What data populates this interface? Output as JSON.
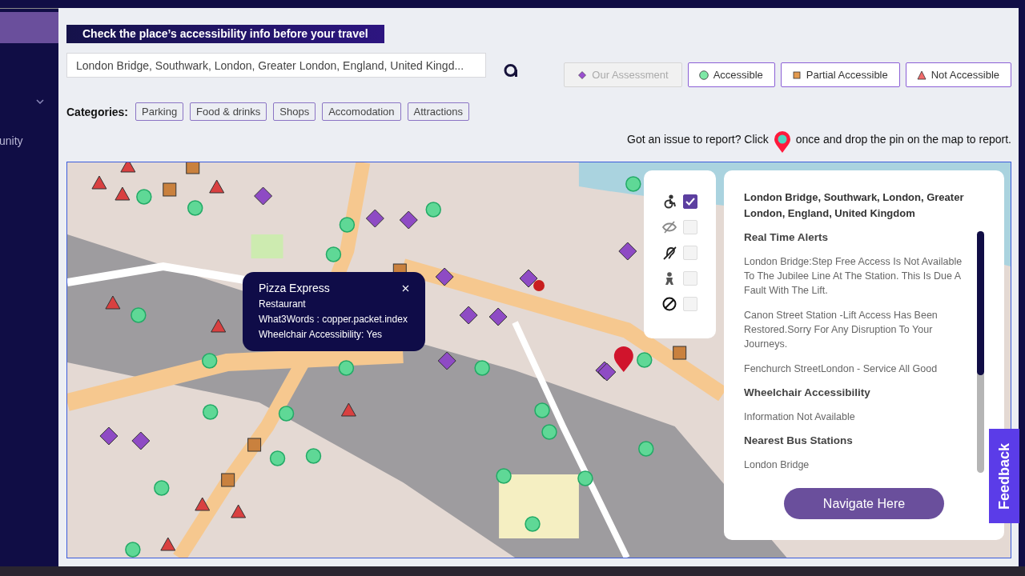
{
  "sidebar": {
    "partial_label": "unity"
  },
  "header_banner": "Check the place’s accessibility info before your travel",
  "search": {
    "value": "London Bridge, Southwark, London, Greater London, England, United Kingd..."
  },
  "legend": [
    {
      "label": "Our Assessment",
      "kind": "diamond",
      "disabled": true
    },
    {
      "label": "Accessible",
      "kind": "circle",
      "disabled": false
    },
    {
      "label": "Partial Accessible",
      "kind": "square",
      "disabled": false
    },
    {
      "label": "Not Accessible",
      "kind": "triangle",
      "disabled": false
    }
  ],
  "categories": {
    "label": "Categories:",
    "items": [
      "Parking",
      "Food & drinks",
      "Shops",
      "Accomodation",
      "Attractions"
    ]
  },
  "report": {
    "before": "Got an issue to report? Click",
    "after": "once and drop the pin on the map to report."
  },
  "popup": {
    "title": "Pizza Express",
    "lines": [
      "Restaurant",
      "What3Words : copper.packet.index",
      "Wheelchair Accessibility: Yes"
    ]
  },
  "filters": [
    {
      "kind": "wheelchair",
      "checked": true
    },
    {
      "kind": "vision",
      "checked": false
    },
    {
      "kind": "hearing",
      "checked": false
    },
    {
      "kind": "mobility",
      "checked": false
    },
    {
      "kind": "none",
      "checked": false
    }
  ],
  "info": {
    "title": "London Bridge, Southwark, London, Greater London, England, United Kingdom",
    "sections": [
      {
        "heading": "Real Time Alerts",
        "items": [
          "London Bridge:Step Free Access Is Not Available To The Jubilee Line At The Station. This Is Due A Fault With The Lift.",
          "Canon Street Station -Lift Access Has Been Restored.Sorry For Any Disruption To Your Journeys.",
          "Fenchurch StreetLondon - Service All Good"
        ]
      },
      {
        "heading": "Wheelchair Accessibility",
        "items": [
          "Information Not Available"
        ]
      },
      {
        "heading": "Nearest Bus Stations",
        "items": [
          "London Bridge"
        ]
      }
    ],
    "button": "Navigate Here"
  },
  "feedback": "Feedback"
}
